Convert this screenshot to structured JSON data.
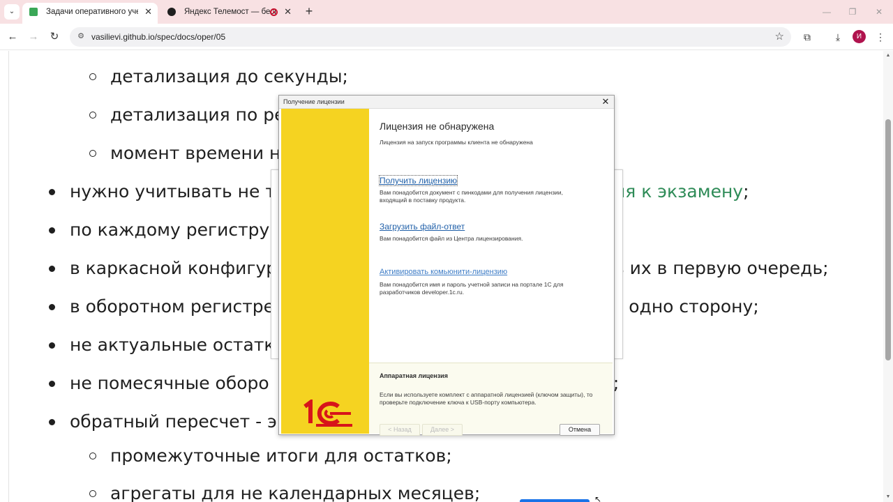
{
  "browser": {
    "tabs": [
      {
        "title": "Задачи оперативного учета | ",
        "active": true
      },
      {
        "title": "Яндекс Телемост — беспл",
        "active": false
      }
    ],
    "new_tab": "+",
    "tab_menu": "⌄",
    "url": "vasilievi.github.io/spec/docs/oper/05",
    "profile_initial": "И",
    "window_controls": [
      "—",
      "❐",
      "✕"
    ]
  },
  "page": {
    "lines": [
      {
        "kind": "sub",
        "text": "детализация до секунды;"
      },
      {
        "kind": "sub",
        "text": "детализация по ре"
      },
      {
        "kind": "sub",
        "text": "момент времени н"
      },
      {
        "kind": "main",
        "text": "нужно учитывать не т",
        "tail_link": "ия к экзамену",
        "tail": ";"
      },
      {
        "kind": "main",
        "text": "по каждому регистру"
      },
      {
        "kind": "main",
        "text": "в каркасной конфигур",
        "tail": "ь их в первую очередь;"
      },
      {
        "kind": "main",
        "text": "в оборотном регистре",
        "tail": "з одно сторону;"
      },
      {
        "kind": "main",
        "text": "не актуальные остатк"
      },
      {
        "kind": "main",
        "text": "не помесячные оборо",
        "tail": "м;"
      },
      {
        "kind": "main",
        "text": "обратный пересчет - э"
      },
      {
        "kind": "sub",
        "text": "промежуточные итоги для остатков;"
      },
      {
        "kind": "sub",
        "text": "агрегаты для не календарных месяцев;"
      }
    ]
  },
  "dialog": {
    "title": "Получение лицензии",
    "heading": "Лицензия не обнаружена",
    "subheading": "Лицензия на запуск программы клиента не обнаружена",
    "actions": [
      {
        "label": "Получить лицензию",
        "desc": "Вам понадобится документ с пинкодами для получения лицензии, входящий в поставку продукта."
      },
      {
        "label": "Загрузить файл-ответ",
        "desc": "Вам понадобится файл из Центра лицензирования."
      },
      {
        "label": "Активировать комьюнити-лицензию",
        "desc": "Вам понадобится имя и пароль учетной записи на портале 1С для разработчиков developer.1c.ru."
      }
    ],
    "hardware": {
      "title": "Аппаратная лицензия",
      "desc": "Если вы используете комплект с аппаратной лицензией (ключом защиты), то проверьте подключение ключа к USB-порту компьютера."
    },
    "buttons": {
      "back": "< Назад",
      "next": "Далее >",
      "cancel": "Отмена"
    }
  },
  "colors": {
    "accent_yellow": "#f5d321",
    "logo_red": "#d7141a",
    "link_blue": "#1f5fa8",
    "page_link": "#2e8b57"
  }
}
